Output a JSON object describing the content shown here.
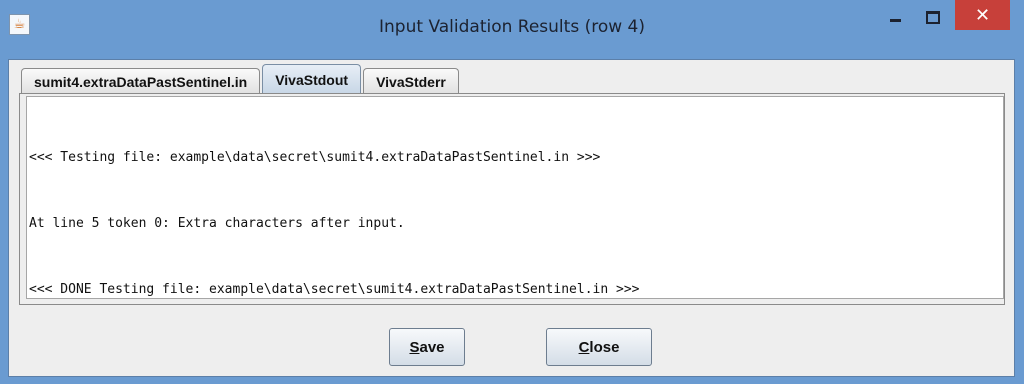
{
  "window": {
    "title": "Input Validation Results (row 4)",
    "icon": "java-cup-icon",
    "close_glyph": "✕"
  },
  "tabs": [
    {
      "label": "sumit4.extraDataPastSentinel.in",
      "active": false
    },
    {
      "label": "VivaStdout",
      "active": true
    },
    {
      "label": "VivaStderr",
      "active": false
    }
  ],
  "output": {
    "lines": [
      "<<< Testing file: example\\data\\secret\\sumit4.extraDataPastSentinel.in >>>",
      "At line 5 token 0: Extra characters after input.",
      "<<< DONE Testing file: example\\data\\secret\\sumit4.extraDataPastSentinel.in >>>"
    ]
  },
  "buttons": {
    "save_mnemonic": "S",
    "save_rest": "ave",
    "close_mnemonic": "C",
    "close_rest": "lose"
  },
  "colors": {
    "titlebar": "#6a9bd1",
    "close_button": "#c7403a",
    "panel": "#eeeeee"
  }
}
